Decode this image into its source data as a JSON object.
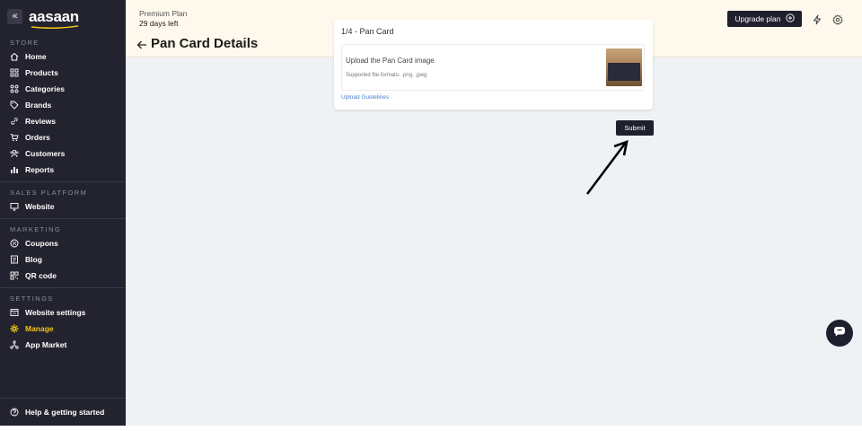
{
  "sidebar": {
    "logo": "aasaan",
    "collapse_icon": "chevrons-left-icon",
    "sections": {
      "store": "STORE",
      "sales": "SALES PLATFORM",
      "marketing": "MARKETING",
      "settings": "SETTINGS"
    },
    "items": {
      "home": "Home",
      "products": "Products",
      "categories": "Categories",
      "brands": "Brands",
      "reviews": "Reviews",
      "orders": "Orders",
      "customers": "Customers",
      "reports": "Reports",
      "website": "Website",
      "coupons": "Coupons",
      "blog": "Blog",
      "qr": "QR code",
      "website_settings": "Website settings",
      "manage": "Manage",
      "app_market": "App Market"
    },
    "help": "Help & getting started",
    "colors": {
      "bg": "#23232f",
      "active": "#f5c518",
      "accent": "#f5c518"
    }
  },
  "topbar": {
    "plan_name": "Premium Plan",
    "plan_days": "29 days left",
    "upgrade_label": "Upgrade plan"
  },
  "page": {
    "title": "Pan Card Details"
  },
  "card": {
    "title": "1/4 - Pan Card",
    "upload_label": "Upload the Pan Card image",
    "formats": "Supported file formats- .png, .jpeg",
    "guidelines": "Upload Guidelines"
  },
  "actions": {
    "submit": "Submit"
  }
}
